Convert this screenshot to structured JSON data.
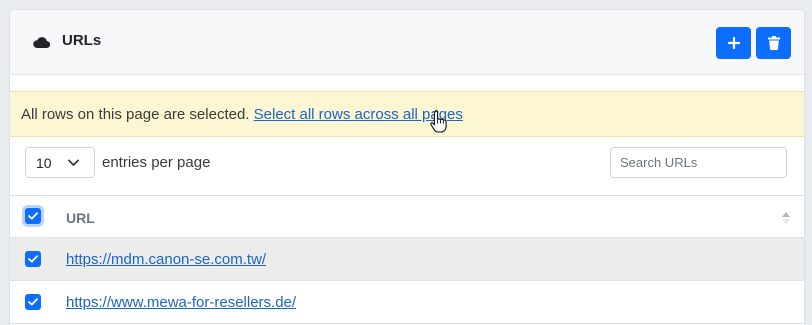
{
  "header": {
    "title": "URLs",
    "add_label": "+",
    "delete_icon": "trash-icon",
    "cloud_icon": "cloud-icon"
  },
  "selection_banner": {
    "message": "All rows on this page are selected.",
    "link": "Select all rows across all pages"
  },
  "controls": {
    "page_size": "10",
    "entries_label": "entries per page",
    "search_placeholder": "Search URLs"
  },
  "table": {
    "columns": [
      "URL"
    ],
    "rows": [
      {
        "url": "https://mdm.canon-se.com.tw/",
        "selected": true
      },
      {
        "url": "https://www.mewa-for-resellers.de/",
        "selected": true
      }
    ]
  },
  "colors": {
    "primary": "#0d6efd",
    "link": "#1c64c6",
    "banner_bg": "#fdf6d3"
  }
}
